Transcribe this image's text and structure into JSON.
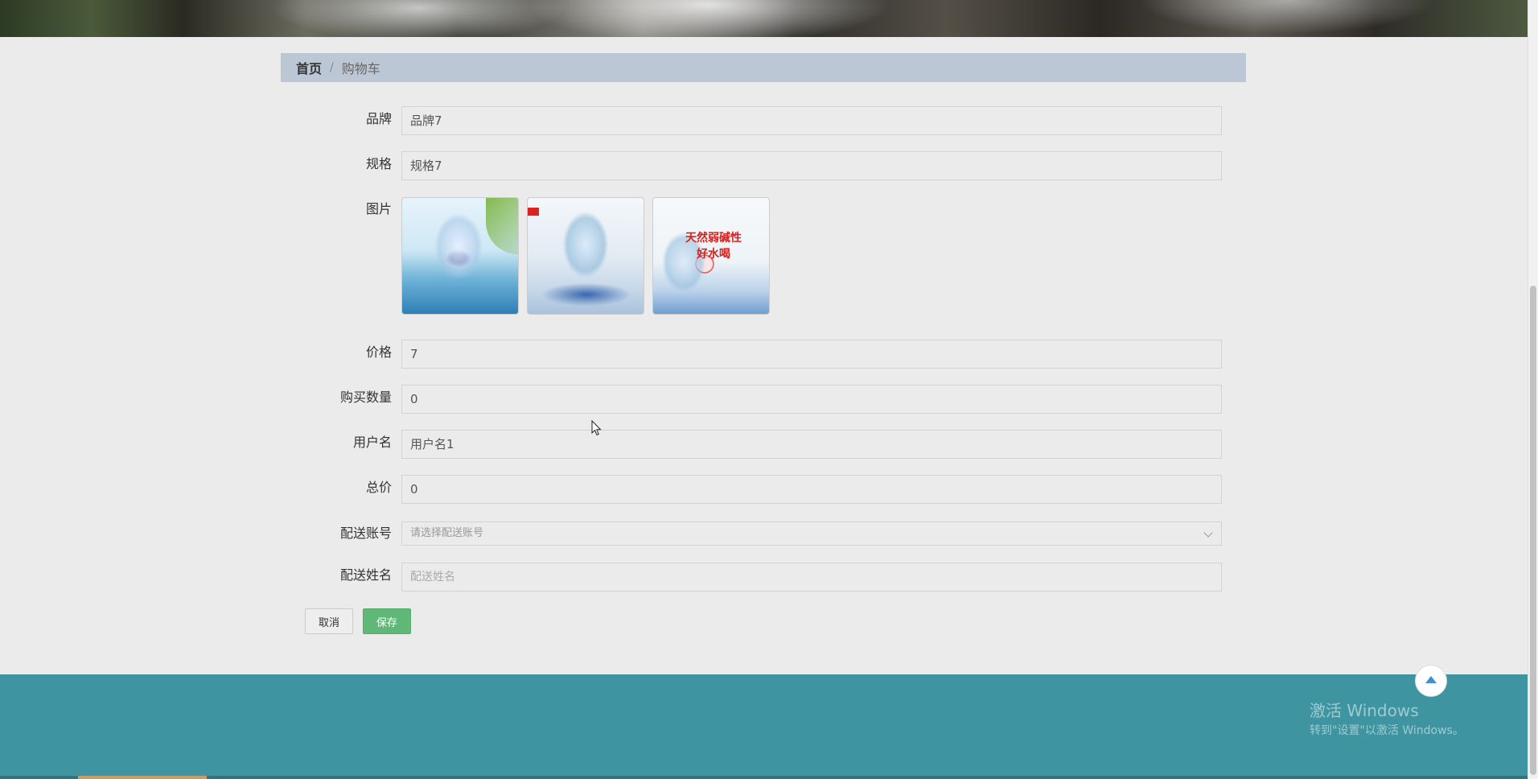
{
  "breadcrumb": {
    "home": "首页",
    "separator": "/",
    "current": "购物车"
  },
  "form": {
    "brand": {
      "label": "品牌",
      "value": "品牌7"
    },
    "spec": {
      "label": "规格",
      "value": "规格7"
    },
    "images": {
      "label": "图片",
      "image3_text_line1": "天然弱碱性",
      "image3_text_line2": "好水喝"
    },
    "price": {
      "label": "价格",
      "value": "7"
    },
    "quantity": {
      "label": "购买数量",
      "value": "0"
    },
    "username": {
      "label": "用户名",
      "value": "用户名1"
    },
    "total": {
      "label": "总价",
      "value": "0"
    },
    "delivery_account": {
      "label": "配送账号",
      "placeholder": "请选择配送账号"
    },
    "delivery_name": {
      "label": "配送姓名",
      "placeholder": "配送姓名"
    }
  },
  "buttons": {
    "cancel": "取消",
    "save": "保存"
  },
  "watermark": {
    "line1": "激活 Windows",
    "line2": "转到\"设置\"以激活 Windows。"
  },
  "colors": {
    "breadcrumb_bg": "#bcc7d6",
    "save_button": "#5fb878",
    "footer": "#3e95a1",
    "back_top_arrow": "#3e8fd4"
  },
  "icons": {
    "back_to_top": "arrow-up-icon",
    "select_chevron": "chevron-down-icon",
    "cursor": "mouse-pointer-icon"
  }
}
